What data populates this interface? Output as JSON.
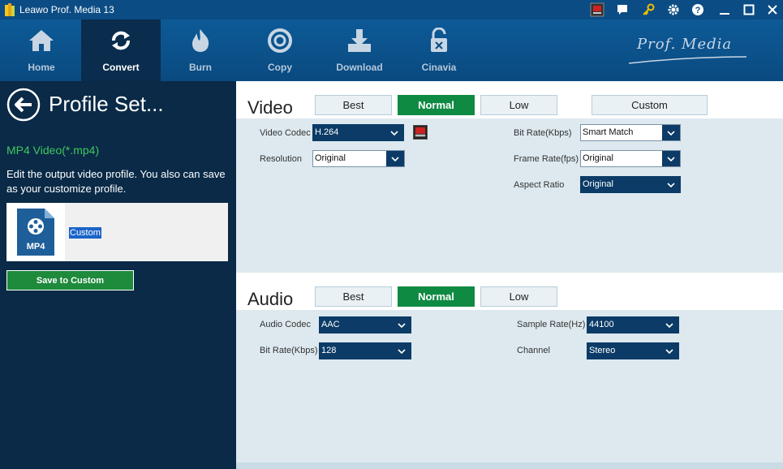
{
  "titlebar": {
    "app_title": "Leawo Prof. Media 13"
  },
  "nav": {
    "items": [
      {
        "label": "Home",
        "icon": "home-icon"
      },
      {
        "label": "Convert",
        "icon": "convert-icon"
      },
      {
        "label": "Burn",
        "icon": "burn-icon"
      },
      {
        "label": "Copy",
        "icon": "copy-icon"
      },
      {
        "label": "Download",
        "icon": "download-icon"
      },
      {
        "label": "Cinavia",
        "icon": "cinavia-icon"
      }
    ],
    "active": "Convert",
    "brand": "Prof. Media"
  },
  "left": {
    "title": "Profile Set...",
    "format_name": "MP4 Video(*.mp4)",
    "description": "Edit the output video profile. You also can save as your customize profile.",
    "profile_thumb_label": "MP4",
    "profile_name": "Custom",
    "save_button": "Save to Custom"
  },
  "video": {
    "title": "Video",
    "quality_buttons": [
      "Best",
      "Normal",
      "Low",
      "Custom"
    ],
    "active_quality": "Normal",
    "codec_label": "Video Codec",
    "codec_value": "H.264",
    "resolution_label": "Resolution",
    "resolution_value": "Original",
    "bitrate_label": "Bit Rate(Kbps)",
    "bitrate_value": "Smart Match",
    "framerate_label": "Frame Rate(fps)",
    "framerate_value": "Original",
    "aspect_label": "Aspect Ratio",
    "aspect_value": "Original"
  },
  "audio": {
    "title": "Audio",
    "quality_buttons": [
      "Best",
      "Normal",
      "Low"
    ],
    "active_quality": "Normal",
    "codec_label": "Audio Codec",
    "codec_value": "AAC",
    "bitrate_label": "Bit Rate(Kbps)",
    "bitrate_value": "128",
    "samplerate_label": "Sample Rate(Hz)",
    "samplerate_value": "44100",
    "channel_label": "Channel",
    "channel_value": "Stereo"
  },
  "colors": {
    "accent_green": "#0f8a43",
    "title_bar": "#0b4c84",
    "left_panel": "#0a2a47"
  }
}
